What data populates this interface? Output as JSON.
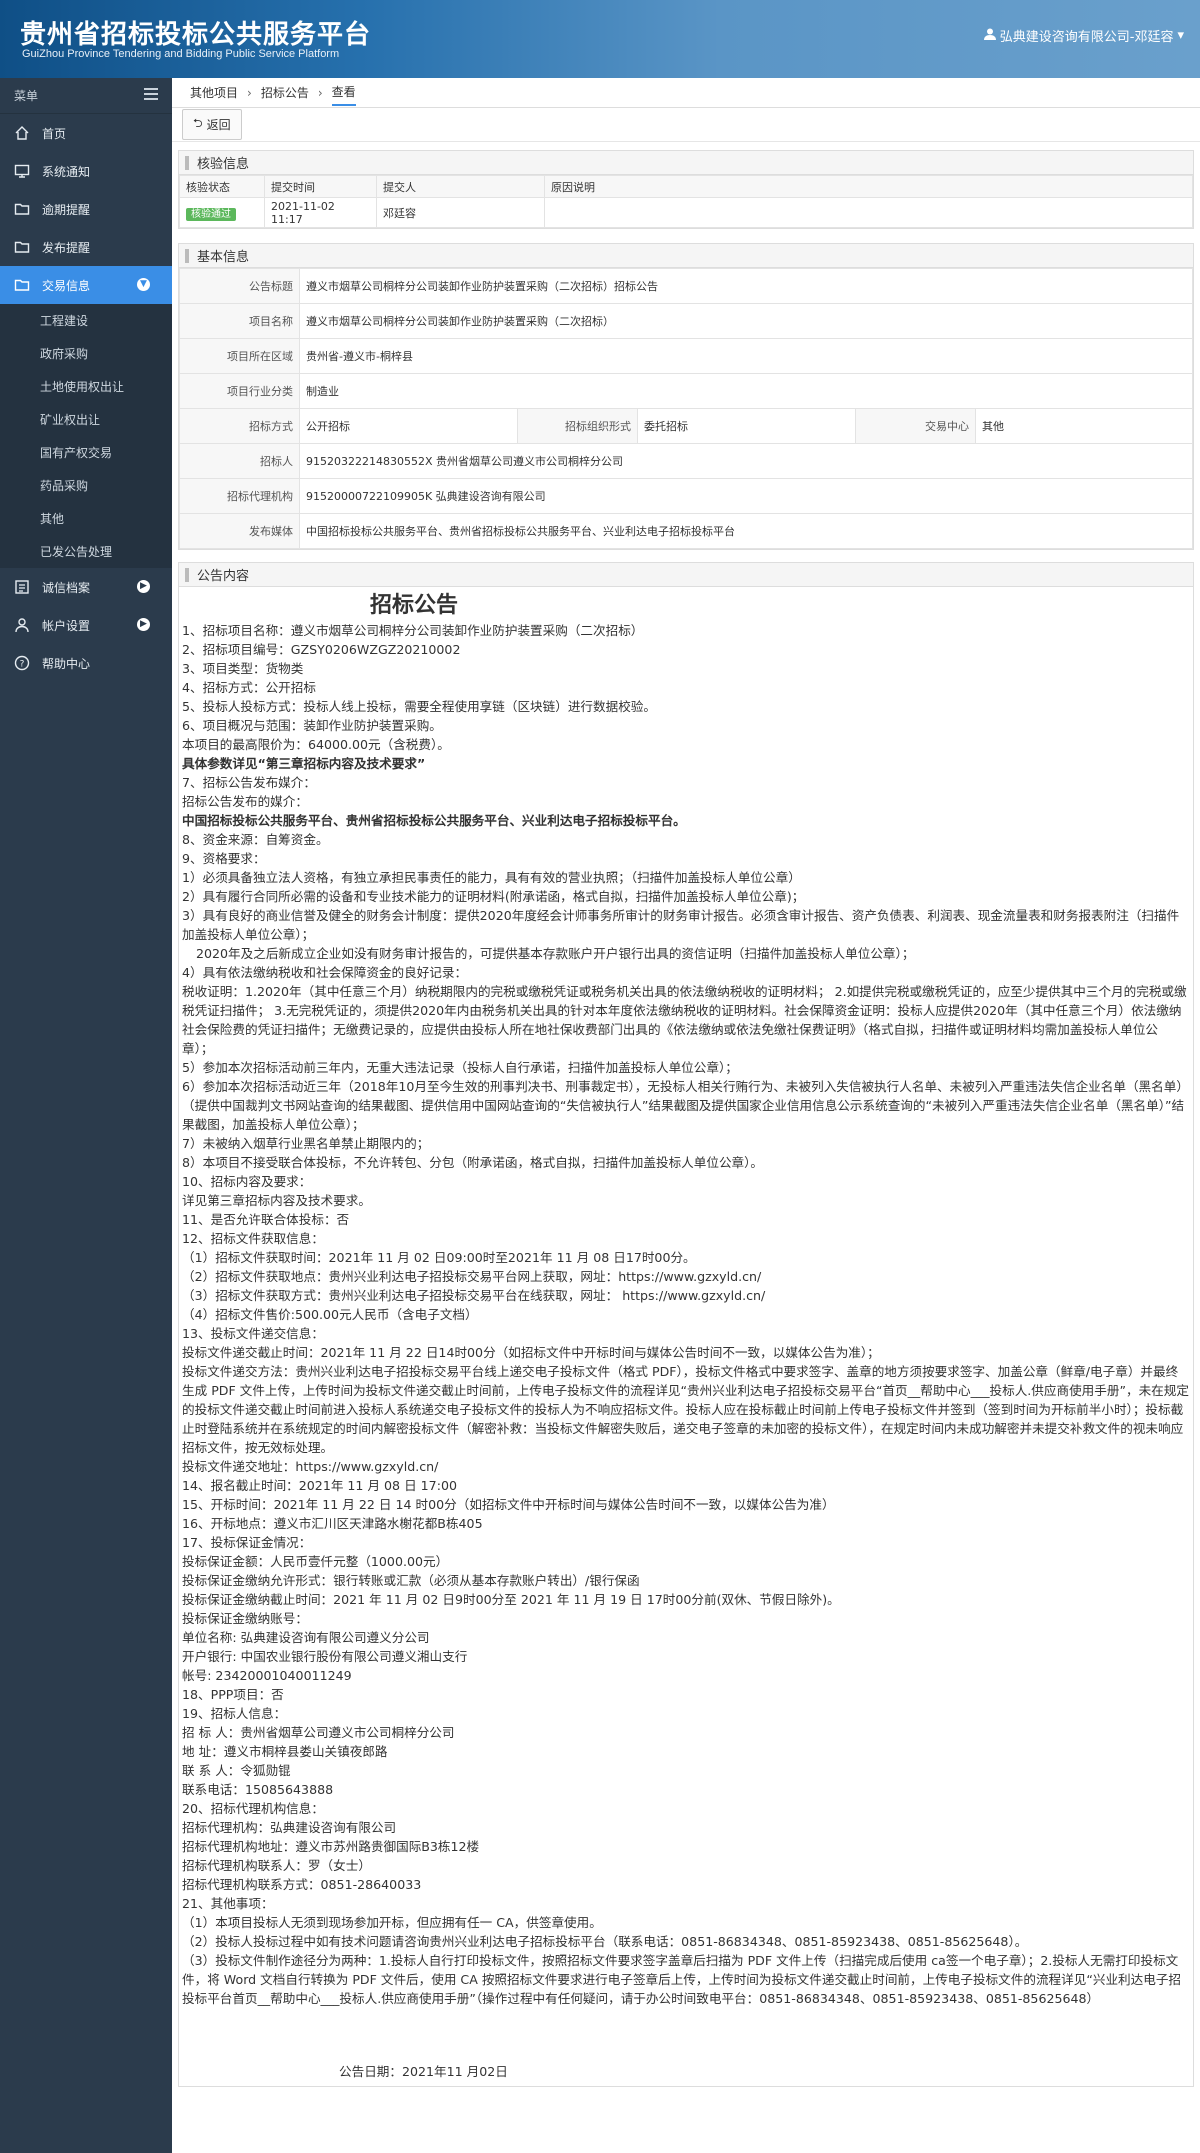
{
  "header": {
    "title": "贵州省招标投标公共服务平台",
    "subtitle": "GuiZhou Province Tendering and Bidding Public Service Platform",
    "user": "弘典建设咨询有限公司-邓廷容"
  },
  "sidebar": {
    "menu_label": "菜单",
    "items": [
      {
        "label": "首页",
        "icon": "home-icon"
      },
      {
        "label": "系统通知",
        "icon": "monitor-icon"
      },
      {
        "label": "逾期提醒",
        "icon": "folder-icon"
      },
      {
        "label": "发布提醒",
        "icon": "folder-icon"
      },
      {
        "label": "交易信息",
        "icon": "folder-icon",
        "active": true
      }
    ],
    "sub_items": [
      "工程建设",
      "政府采购",
      "土地使用权出让",
      "矿业权出让",
      "国有产权交易",
      "药品采购",
      "其他",
      "已发公告处理"
    ],
    "bottom_items": [
      {
        "label": "诚信档案",
        "icon": "list-icon"
      },
      {
        "label": "帐户设置",
        "icon": "user-icon"
      },
      {
        "label": "帮助中心",
        "icon": "help-icon"
      }
    ]
  },
  "breadcrumb": [
    "其他项目",
    "招标公告",
    "查看"
  ],
  "back_label": "返回",
  "verify": {
    "title": "核验信息",
    "headers": [
      "核验状态",
      "提交时间",
      "提交人",
      "原因说明"
    ],
    "status": "核验通过",
    "time": "2021-11-02 11:17",
    "person": "邓廷容",
    "reason": ""
  },
  "basic": {
    "title": "基本信息",
    "announce_title_label": "公告标题",
    "announce_title": "遵义市烟草公司桐梓分公司装卸作业防护装置采购（二次招标）招标公告",
    "project_name_label": "项目名称",
    "project_name": "遵义市烟草公司桐梓分公司装卸作业防护装置采购（二次招标）",
    "region_label": "项目所在区域",
    "region": "贵州省-遵义市-桐梓县",
    "industry_label": "项目行业分类",
    "industry": "制造业",
    "method_label": "招标方式",
    "method": "公开招标",
    "org_form_label": "招标组织形式",
    "org_form": "委托招标",
    "center_label": "交易中心",
    "center": "其他",
    "tenderer_label": "招标人",
    "tenderer": "91520322214830552X 贵州省烟草公司遵义市公司桐梓分公司",
    "agency_label": "招标代理机构",
    "agency": "91520000722109905K 弘典建设咨询有限公司",
    "media_label": "发布媒体",
    "media": "中国招标投标公共服务平台、贵州省招标投标公共服务平台、兴业利达电子招标投标平台"
  },
  "content": {
    "title": "公告内容",
    "heading": "招标公告",
    "lines": [
      "1、招标项目名称：遵义市烟草公司桐梓分公司装卸作业防护装置采购（二次招标）",
      "2、招标项目编号：GZSY0206WZGZ20210002",
      "3、项目类型：货物类",
      "4、招标方式：公开招标",
      "5、投标人投标方式：投标人线上投标，需要全程使用享链（区块链）进行数据校验。",
      "6、项目概况与范围：装卸作业防护装置采购。",
      "本项目的最高限价为：64000.00元（含税费）。"
    ],
    "bold1": "具体参数详见“第三章招标内容及技术要求”",
    "lines2": [
      "7、招标公告发布媒介：",
      "招标公告发布的媒介："
    ],
    "media_bold": "中国招标投标公共服务平台、贵州省招标投标公共服务平台、兴业利达电子招标投标平台。",
    "lines3": [
      "8、资金来源：自筹资金。",
      "9、资格要求：",
      "1）必须具备独立法人资格，有独立承担民事责任的能力，具有有效的营业执照；（扫描件加盖投标人单位公章）",
      "2）具有履行合同所必需的设备和专业技术能力的证明材料(附承诺函，格式自拟，扫描件加盖投标人单位公章)；",
      "3）具有良好的商业信誉及健全的财务会计制度：提供2020年度经会计师事务所审计的财务审计报告。必须含审计报告、资产负债表、利润表、现金流量表和财务报表附注（扫描件加盖投标人单位公章）；"
    ],
    "indent1": "2020年及之后新成立企业如没有财务审计报告的，可提供基本存款账户开户银行出具的资信证明（扫描件加盖投标人单位公章）；",
    "lines4": [
      "4）具有依法缴纳税收和社会保障资金的良好记录：",
      "税收证明：1.2020年（其中任意三个月）纳税期限内的完税或缴税凭证或税务机关出具的依法缴纳税收的证明材料；  2.如提供完税或缴税凭证的，应至少提供其中三个月的完税或缴税凭证扫描件；  3.无完税凭证的，须提供2020年内由税务机关出具的针对本年度依法缴纳税收的证明材料。社会保障资金证明：投标人应提供2020年（其中任意三个月）依法缴纳社会保险费的凭证扫描件；无缴费记录的，应提供由投标人所在地社保收费部门出具的《依法缴纳或依法免缴社保费证明》（格式自拟，扫描件或证明材料均需加盖投标人单位公章）；",
      "5）参加本次招标活动前三年内，无重大违法记录（投标人自行承诺，扫描件加盖投标人单位公章）；",
      "6）参加本次招标活动近三年（2018年10月至今生效的刑事判决书、刑事裁定书），无投标人相关行贿行为、未被列入失信被执行人名单、未被列入严重违法失信企业名单（黑名单）（提供中国裁判文书网站查询的结果截图、提供信用中国网站查询的“失信被执行人”结果截图及提供国家企业信用信息公示系统查询的“未被列入严重违法失信企业名单（黑名单）”结果截图，加盖投标人单位公章）；",
      "7）未被纳入烟草行业黑名单禁止期限内的；",
      "8）本项目不接受联合体投标，不允许转包、分包（附承诺函，格式自拟，扫描件加盖投标人单位公章）。",
      "10、招标内容及要求：",
      "详见第三章招标内容及技术要求。",
      "11、是否允许联合体投标：否",
      "12、招标文件获取信息：",
      "（1）招标文件获取时间：2021年 11 月 02 日09:00时至2021年 11 月 08 日17时00分。",
      "（2）招标文件获取地点：贵州兴业利达电子招投标交易平台网上获取，网址：https://www.gzxyld.cn/",
      "（3）招标文件获取方式：贵州兴业利达电子招投标交易平台在线获取，网址： https://www.gzxyld.cn/",
      "（4）招标文件售价:500.00元人民币（含电子文档）",
      "13、投标文件递交信息：",
      "投标文件递交截止时间：2021年 11 月 22 日14时00分（如招标文件中开标时间与媒体公告时间不一致，以媒体公告为准）；",
      "投标文件递交方法：贵州兴业利达电子招投标交易平台线上递交电子投标文件（格式 PDF），投标文件格式中要求签字、盖章的地方须按要求签字、加盖公章（鲜章/电子章）并最终生成 PDF 文件上传，上传时间为投标文件递交截止时间前，上传电子投标文件的流程详见“贵州兴业利达电子招投标交易平台“首页__帮助中心___投标人.供应商使用手册”，未在规定的投标文件递交截止时间前进入投标人系统递交电子投标文件的投标人为不响应招标文件。投标人应在投标截止时间前上传电子投标文件并签到（签到时间为开标前半小时）；投标截止时登陆系统并在系统规定的时间内解密投标文件（解密补救：当投标文件解密失败后，递交电子签章的未加密的投标文件），在规定时间内未成功解密并未提交补救文件的视未响应招标文件，按无效标处理。",
      "投标文件递交地址：https://www.gzxyld.cn/",
      "14、报名截止时间：2021年 11 月 08 日 17:00",
      "15、开标时间：2021年 11 月 22 日 14 时00分（如招标文件中开标时间与媒体公告时间不一致，以媒体公告为准）",
      "16、开标地点：遵义市汇川区天津路水榭花都B栋405",
      "17、投标保证金情况：",
      "投标保证金额：人民币壹仟元整（1000.00元）",
      "投标保证金缴纳允许形式：银行转账或汇款（必须从基本存款账户转出）/银行保函",
      "投标保证金缴纳截止时间：2021 年 11 月 02 日9时00分至 2021 年 11 月 19 日 17时00分前(双休、节假日除外)。",
      "投标保证金缴纳账号：",
      "单位名称: 弘典建设咨询有限公司遵义分公司",
      "开户银行: 中国农业银行股份有限公司遵义湘山支行",
      "帐号: 23420001040011249",
      "18、PPP项目：否",
      "19、招标人信息：",
      "招 标 人：贵州省烟草公司遵义市公司桐梓分公司",
      "地    址：遵义市桐梓县娄山关镇夜郎路",
      "联 系 人：令狐勋锟",
      "联系电话：15085643888",
      "20、招标代理机构信息：",
      "招标代理机构：弘典建设咨询有限公司",
      "招标代理机构地址：遵义市苏州路贵御国际B3栋12楼",
      "招标代理机构联系人：罗（女士）",
      "招标代理机构联系方式：0851-28640033",
      "21、其他事项：",
      "（1）本项目投标人无须到现场参加开标，但应拥有任一 CA，供签章使用。",
      "（2）投标人投标过程中如有技术问题请咨询贵州兴业利达电子招标投标平台（联系电话：0851-86834348、0851-85923438、0851-85625648）。",
      "（3）投标文件制作途径分为两种：1.投标人自行打印投标文件，按照招标文件要求签字盖章后扫描为 PDF 文件上传（扫描完成后使用 ca签一个电子章）；2.投标人无需打印投标文件，将 Word 文档自行转换为 PDF 文件后，使用 CA 按照招标文件要求进行电子签章后上传，上传时间为投标文件递交截止时间前，上传电子投标文件的流程详见“兴业利达电子招投标平台首页__帮助中心___投标人.供应商使用手册”（操作过程中有任何疑问，请于办公时间致电平台：0851-86834348、0851-85923438、0851-85625648）"
    ],
    "date": "公告日期：2021年11 月02日"
  }
}
